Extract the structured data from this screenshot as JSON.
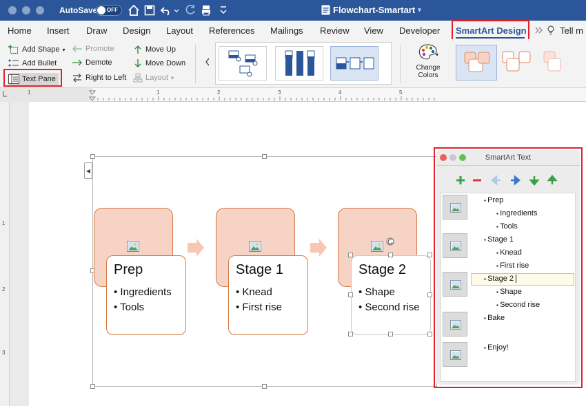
{
  "titlebar": {
    "autosave_label": "AutoSave",
    "autosave_state": "OFF",
    "doc_title": "Flowchart-Smartart"
  },
  "tabs": [
    {
      "label": "Home"
    },
    {
      "label": "Insert"
    },
    {
      "label": "Draw"
    },
    {
      "label": "Design"
    },
    {
      "label": "Layout"
    },
    {
      "label": "References"
    },
    {
      "label": "Mailings"
    },
    {
      "label": "Review"
    },
    {
      "label": "View"
    },
    {
      "label": "Developer"
    },
    {
      "label": "SmartArt Design"
    },
    {
      "label": "Tell m"
    }
  ],
  "ribbon": {
    "add_shape": "Add Shape",
    "add_bullet": "Add Bullet",
    "text_pane": "Text Pane",
    "promote": "Promote",
    "demote": "Demote",
    "right_to_left": "Right to Left",
    "move_up": "Move Up",
    "move_down": "Move Down",
    "layout": "Layout",
    "change_colors_1": "Change",
    "change_colors_2": "Colors"
  },
  "ruler": {
    "h_marks": [
      "1",
      "1",
      "2",
      "3",
      "4",
      "5"
    ],
    "v_marks": [
      "1",
      "2",
      "3"
    ]
  },
  "diagram": {
    "shapes": [
      {
        "title": "Prep",
        "bullets": [
          "Ingredients",
          "Tools"
        ]
      },
      {
        "title": "Stage 1",
        "bullets": [
          "Knead",
          "First rise"
        ]
      },
      {
        "title": "Stage 2",
        "bullets": [
          "Shape",
          "Second rise"
        ]
      }
    ]
  },
  "text_pane": {
    "title": "SmartArt Text",
    "lines": [
      {
        "text": "Prep",
        "level": 1
      },
      {
        "text": "Ingredients",
        "level": 2
      },
      {
        "text": "Tools",
        "level": 2
      },
      {
        "text": "Stage 1",
        "level": 1
      },
      {
        "text": "Knead",
        "level": 2
      },
      {
        "text": "First rise",
        "level": 2
      },
      {
        "text": "Stage 2",
        "level": 1
      },
      {
        "text": "Shape",
        "level": 2
      },
      {
        "text": "Second rise",
        "level": 2
      },
      {
        "text": "Bake",
        "level": 1
      },
      {
        "text": "Enjoy!",
        "level": 1
      }
    ]
  },
  "colors": {
    "title_bar": "#2b579a",
    "accent_red": "#e0222a",
    "shape_fill": "#f7d3c5",
    "shape_border": "#d27a46"
  }
}
